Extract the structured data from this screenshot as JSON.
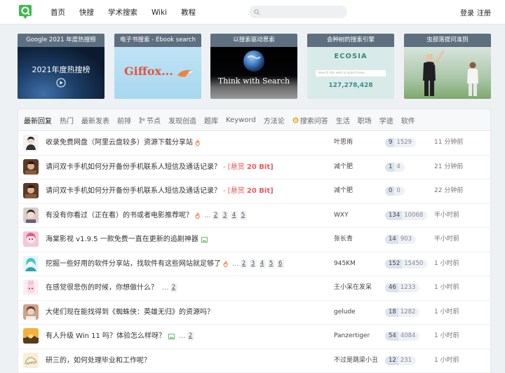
{
  "header": {
    "nav": [
      "首页",
      "快搜",
      "学术搜索",
      "Wiki",
      "教程"
    ],
    "search_placeholder": "",
    "login": "登录",
    "register": "注册"
  },
  "banners": [
    {
      "caption": "Google 2021 年度热搜榜",
      "overlay": "2021年度热搜榜"
    },
    {
      "caption": "电子书搜索 - Ebook search",
      "overlay": "Giffox..."
    },
    {
      "caption": "以搜索驱动思索",
      "overlay": "Think with Search"
    },
    {
      "caption": "会种树的搜索引擎",
      "overlay": "ECOSIA",
      "counter": "127,278,428",
      "search_hint": "Search the web to plant trees..."
    },
    {
      "caption": "虫部落提问准则",
      "overlay": ""
    }
  ],
  "tabs": [
    "最新回复",
    "热门",
    "最新发表",
    "前排",
    "节点",
    "发现创造",
    "题库",
    "Keyword",
    "方法论",
    "搜索问答",
    "生活",
    "职场",
    "学途",
    "软件"
  ],
  "threads": [
    {
      "title": "收录免费网盘（阿里云盘较多）资源下载分享站",
      "fire": true,
      "image": false,
      "bounty": "",
      "bounty_amount": "",
      "pages": [],
      "author": "叶思雨",
      "replies": "9",
      "views": "1529",
      "time": "11 分钟前"
    },
    {
      "title": "请问双卡手机如何分开备份手机联系人短信及通话记录？",
      "fire": false,
      "image": false,
      "bounty": "- [悬赏 ",
      "bounty_amount": "20 Bit]",
      "pages": [],
      "author": "减个肥",
      "replies": "1",
      "views": "4",
      "time": "21 分钟前"
    },
    {
      "title": "请问双卡手机如何分开备份手机联系人短信及通话记录？",
      "fire": false,
      "image": false,
      "bounty": "- [悬赏 ",
      "bounty_amount": "20 Bit]",
      "pages": [],
      "author": "减个肥",
      "replies": "0",
      "views": "0",
      "time": "22 分钟前"
    },
    {
      "title": "有没有你看过（正在看）的书或者电影推荐呢？",
      "fire": true,
      "image": false,
      "bounty": "",
      "bounty_amount": "",
      "pages": [
        "2",
        "3",
        "4",
        "5"
      ],
      "author": "WXY",
      "replies": "134",
      "views": "10068",
      "time": "半小时前"
    },
    {
      "title": "海棠影视 v1.9.5 一款免费一直在更新的追剧神器",
      "fire": false,
      "image": true,
      "bounty": "",
      "bounty_amount": "",
      "pages": [],
      "author": "张长青",
      "replies": "14",
      "views": "903",
      "time": "半小时前"
    },
    {
      "title": "挖掘一些好用的软件分享站，找软件有这些网站就足够了",
      "fire": true,
      "image": false,
      "bounty": "",
      "bounty_amount": "",
      "pages": [
        "2",
        "3",
        "4",
        "5",
        "6"
      ],
      "author": "945KM",
      "replies": "152",
      "views": "15450",
      "time": "1 小时前"
    },
    {
      "title": "在感觉很悲伤的时候，你想做什么？",
      "fire": false,
      "image": false,
      "bounty": "",
      "bounty_amount": "",
      "pages": [
        "2"
      ],
      "author": "王小呆在发呆",
      "replies": "46",
      "views": "1233",
      "time": "1 小时前"
    },
    {
      "title": "大佬们现在能找得到《蜘蛛侠：英雄无归》的资源吗？",
      "fire": false,
      "image": false,
      "bounty": "",
      "bounty_amount": "",
      "pages": [],
      "author": "gelude",
      "replies": "18",
      "views": "1282",
      "time": "1 小时前"
    },
    {
      "title": "有人升级 Win 11 吗？体验怎么样呀？",
      "fire": false,
      "image": true,
      "bounty": "",
      "bounty_amount": "",
      "pages": [
        "2"
      ],
      "author": "Panzertiger",
      "replies": "54",
      "views": "4084",
      "time": "1 小时前"
    },
    {
      "title": "研三的，如何处理毕业和工作呢？",
      "fire": false,
      "image": false,
      "bounty": "",
      "bounty_amount": "",
      "pages": [],
      "author": "不过是跳梁小丑",
      "replies": "12",
      "views": "231",
      "time": "1 小时前"
    }
  ],
  "colors": {
    "accent": "#3fba4f",
    "bounty": "#e45b5b",
    "banner_caption_bg": "#5e6f80"
  }
}
